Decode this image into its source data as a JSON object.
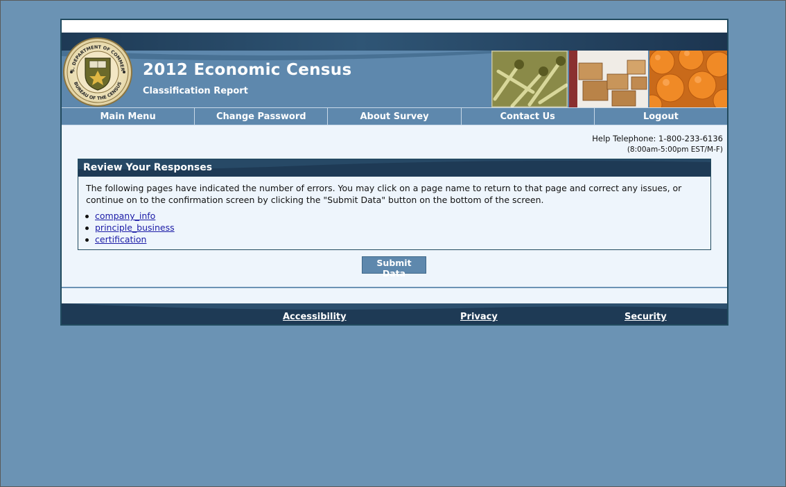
{
  "header": {
    "title": "2012 Economic Census",
    "subtitle": "Classification Report",
    "seal_icon": "census-bureau-seal-icon",
    "seal_top_text": "U.S. DEPARTMENT OF COMMERCE",
    "seal_bottom_text": "BUREAU OF THE CENSUS"
  },
  "nav": {
    "items": [
      {
        "label": "Main Menu"
      },
      {
        "label": "Change Password"
      },
      {
        "label": "About Survey"
      },
      {
        "label": "Contact Us"
      },
      {
        "label": "Logout"
      }
    ]
  },
  "help": {
    "telephone": "Help Telephone: 1-800-233-6136",
    "hours": "(8:00am-5:00pm EST/M-F)"
  },
  "review": {
    "title": "Review Your Responses",
    "text": "The following pages have indicated the number of errors. You may click on a page name to return to that page and correct any issues, or continue on to the confirmation screen by clicking the \"Submit Data\" button on the bottom of the screen.",
    "links": [
      {
        "label": "company_info"
      },
      {
        "label": "principle_business"
      },
      {
        "label": "certification"
      }
    ]
  },
  "submit": {
    "label": "Submit Data"
  },
  "footer": {
    "links": [
      {
        "label": "Accessibility"
      },
      {
        "label": "Privacy"
      },
      {
        "label": "Security"
      }
    ]
  },
  "colors": {
    "background": "#6b93b4",
    "header_blue": "#5e88ad",
    "dark_navy": "#1e3a55",
    "page_bg": "#eef5fc",
    "link": "#1a1aa6"
  }
}
